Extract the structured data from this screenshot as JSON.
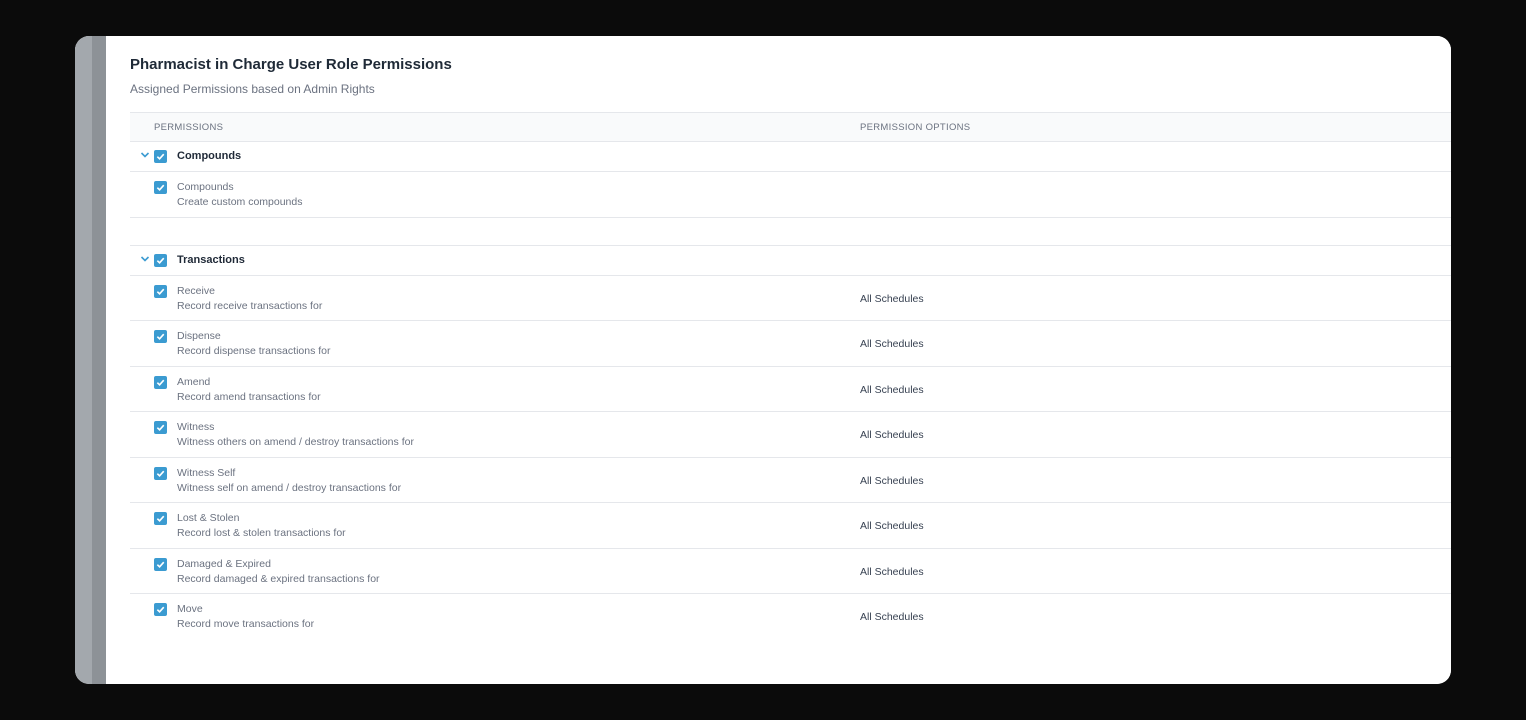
{
  "panel": {
    "title": "Pharmacist in Charge User Role Permissions",
    "subtitle": "Assigned Permissions based on Admin Rights"
  },
  "table": {
    "col_permissions": "PERMISSIONS",
    "col_options": "PERMISSION OPTIONS"
  },
  "groups": [
    {
      "label": "Compounds",
      "checked": true,
      "expanded": true,
      "items": [
        {
          "name": "Compounds",
          "description": "Create custom compounds",
          "option": "",
          "checked": true
        }
      ]
    },
    {
      "label": "Transactions",
      "checked": true,
      "expanded": true,
      "items": [
        {
          "name": "Receive",
          "description": "Record receive transactions for",
          "option": "All Schedules",
          "checked": true
        },
        {
          "name": "Dispense",
          "description": "Record dispense transactions for",
          "option": "All Schedules",
          "checked": true
        },
        {
          "name": "Amend",
          "description": "Record amend transactions for",
          "option": "All Schedules",
          "checked": true
        },
        {
          "name": "Witness",
          "description": "Witness others on amend / destroy transactions for",
          "option": "All Schedules",
          "checked": true
        },
        {
          "name": "Witness Self",
          "description": "Witness self on amend / destroy transactions for",
          "option": "All Schedules",
          "checked": true
        },
        {
          "name": "Lost & Stolen",
          "description": "Record lost & stolen transactions for",
          "option": "All Schedules",
          "checked": true
        },
        {
          "name": "Damaged & Expired",
          "description": "Record damaged & expired transactions for",
          "option": "All Schedules",
          "checked": true
        },
        {
          "name": "Move",
          "description": "Record move transactions for",
          "option": "All Schedules",
          "checked": true
        }
      ]
    }
  ],
  "colors": {
    "accent": "#3b9bd1",
    "title": "#1f2a37",
    "muted": "#6b7280",
    "border": "#e5e7eb",
    "backdrop": "#0b0b0b"
  },
  "icons": {
    "checkbox": "checkbox-checked-icon",
    "expand": "chevron-down-icon"
  }
}
